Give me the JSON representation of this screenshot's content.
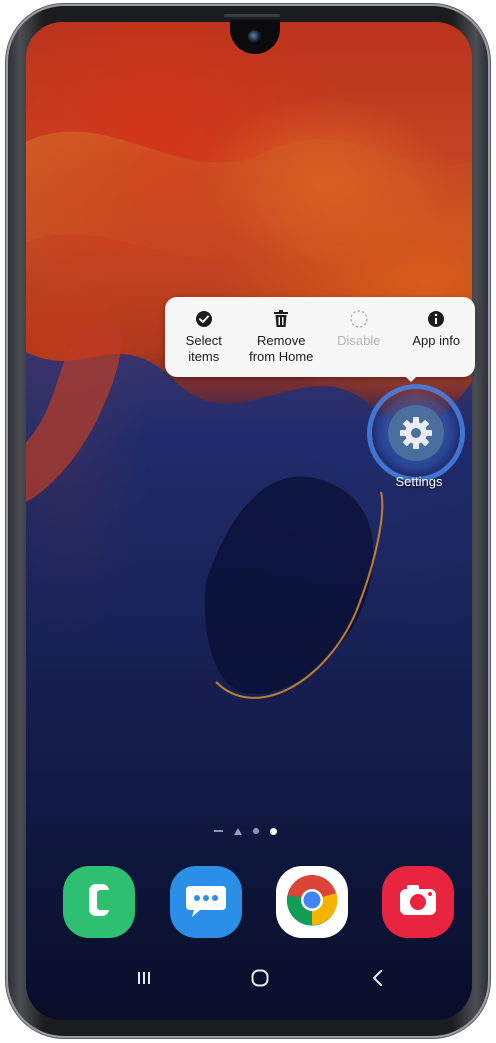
{
  "popup_menu": {
    "items": [
      {
        "label": "Select\nitems",
        "icon": "check-circle-icon",
        "enabled": true
      },
      {
        "label": "Remove\nfrom Home",
        "icon": "trash-icon",
        "enabled": true
      },
      {
        "label": "Disable",
        "icon": "dashed-circle-icon",
        "enabled": false
      },
      {
        "label": "App info",
        "icon": "info-icon",
        "enabled": true
      }
    ]
  },
  "home_app": {
    "label": "Settings",
    "icon": "gear-icon",
    "highlight_color": "#4a86e8"
  },
  "page_indicator": {
    "pages": 3,
    "active_page": 3,
    "has_home_marker": true
  },
  "dock": [
    {
      "app": "Phone",
      "icon": "phone-icon",
      "color": "#2fbf71"
    },
    {
      "app": "Messages",
      "icon": "message-icon",
      "color": "#2b8fe8"
    },
    {
      "app": "Chrome",
      "icon": "chrome-icon",
      "color": "#ffffff"
    },
    {
      "app": "Camera",
      "icon": "camera-icon",
      "color": "#e8243e"
    }
  ],
  "nav_bar": {
    "buttons": [
      "recents",
      "home",
      "back"
    ]
  }
}
